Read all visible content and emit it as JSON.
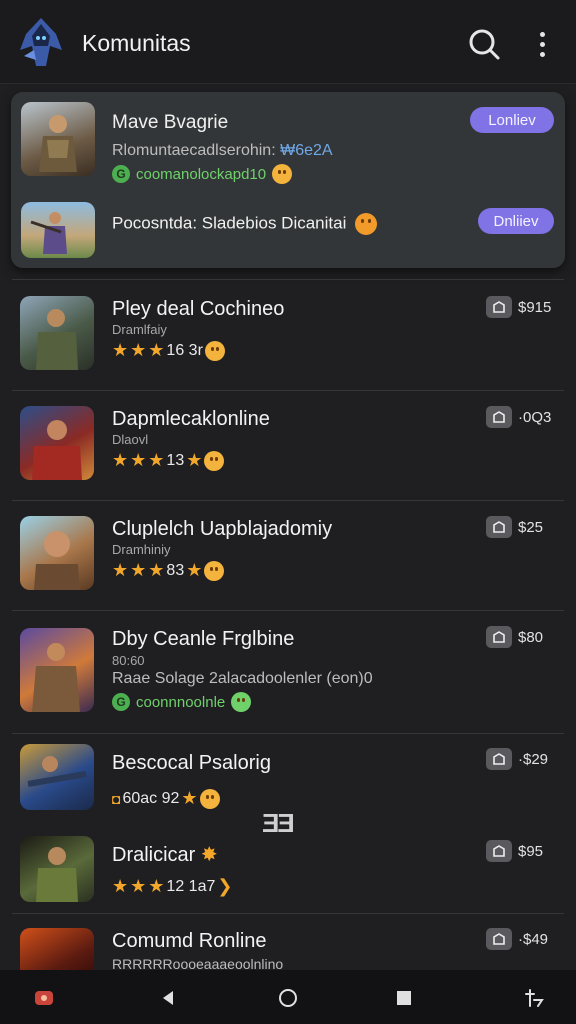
{
  "header": {
    "title": "Komunitas",
    "logo_icon": "hooded-warrior-logo",
    "search_icon": "search-icon",
    "menu_icon": "more-vertical-icon"
  },
  "featured": {
    "item1": {
      "title": "Mave Bvagrie",
      "subtitle": "Rlomuntaecadlserohin: ",
      "subtitle_accent": "₩6e2A",
      "green_text": "coomanolockapd10",
      "button": "Lonliev"
    },
    "item2": {
      "title": "Pocosntda: Sladebios Dicanitai",
      "button": "Dnliiev"
    }
  },
  "list": [
    {
      "title": "Pley deal Cochineo",
      "category": "Dramlfaiy",
      "rating_text": "16 3r",
      "price": "$915"
    },
    {
      "title": "Dapmlecaklonline",
      "category": "Dlaovl",
      "rating_text": "13",
      "price": "·0Q3"
    },
    {
      "title": "Cluplelch Uapblajadomiy",
      "category": "Dramhiniy",
      "rating_text": "83",
      "price": "$25"
    },
    {
      "title": "Dby Ceanle Frglbine",
      "category": "80:60",
      "line": "Raae Solage 2alacadoolenler (eon)0",
      "green_text": "coonnnoolnle",
      "price": "$80"
    },
    {
      "title": "Bescocal Psalorig",
      "rating_text": "60ac 92",
      "price": "·$29"
    },
    {
      "title": "Dralicicar",
      "rating_text": "12 1a7",
      "price": "$95"
    },
    {
      "title": "Comumd Ronline",
      "line": "RRRRRRoooeaaaeoolnlino",
      "price": "·$49"
    }
  ],
  "floating_glyph": "ƎƎ",
  "navbar": {
    "home_icon": "app-home-icon",
    "back_icon": "back-triangle-icon",
    "circle_icon": "home-circle-icon",
    "recent_icon": "recent-square-icon",
    "assist_icon": "assist-icon"
  },
  "colors": {
    "accent": "#7f73e6",
    "background": "#1f1f22",
    "star": "#f2a72a",
    "green": "#6ed16a"
  }
}
